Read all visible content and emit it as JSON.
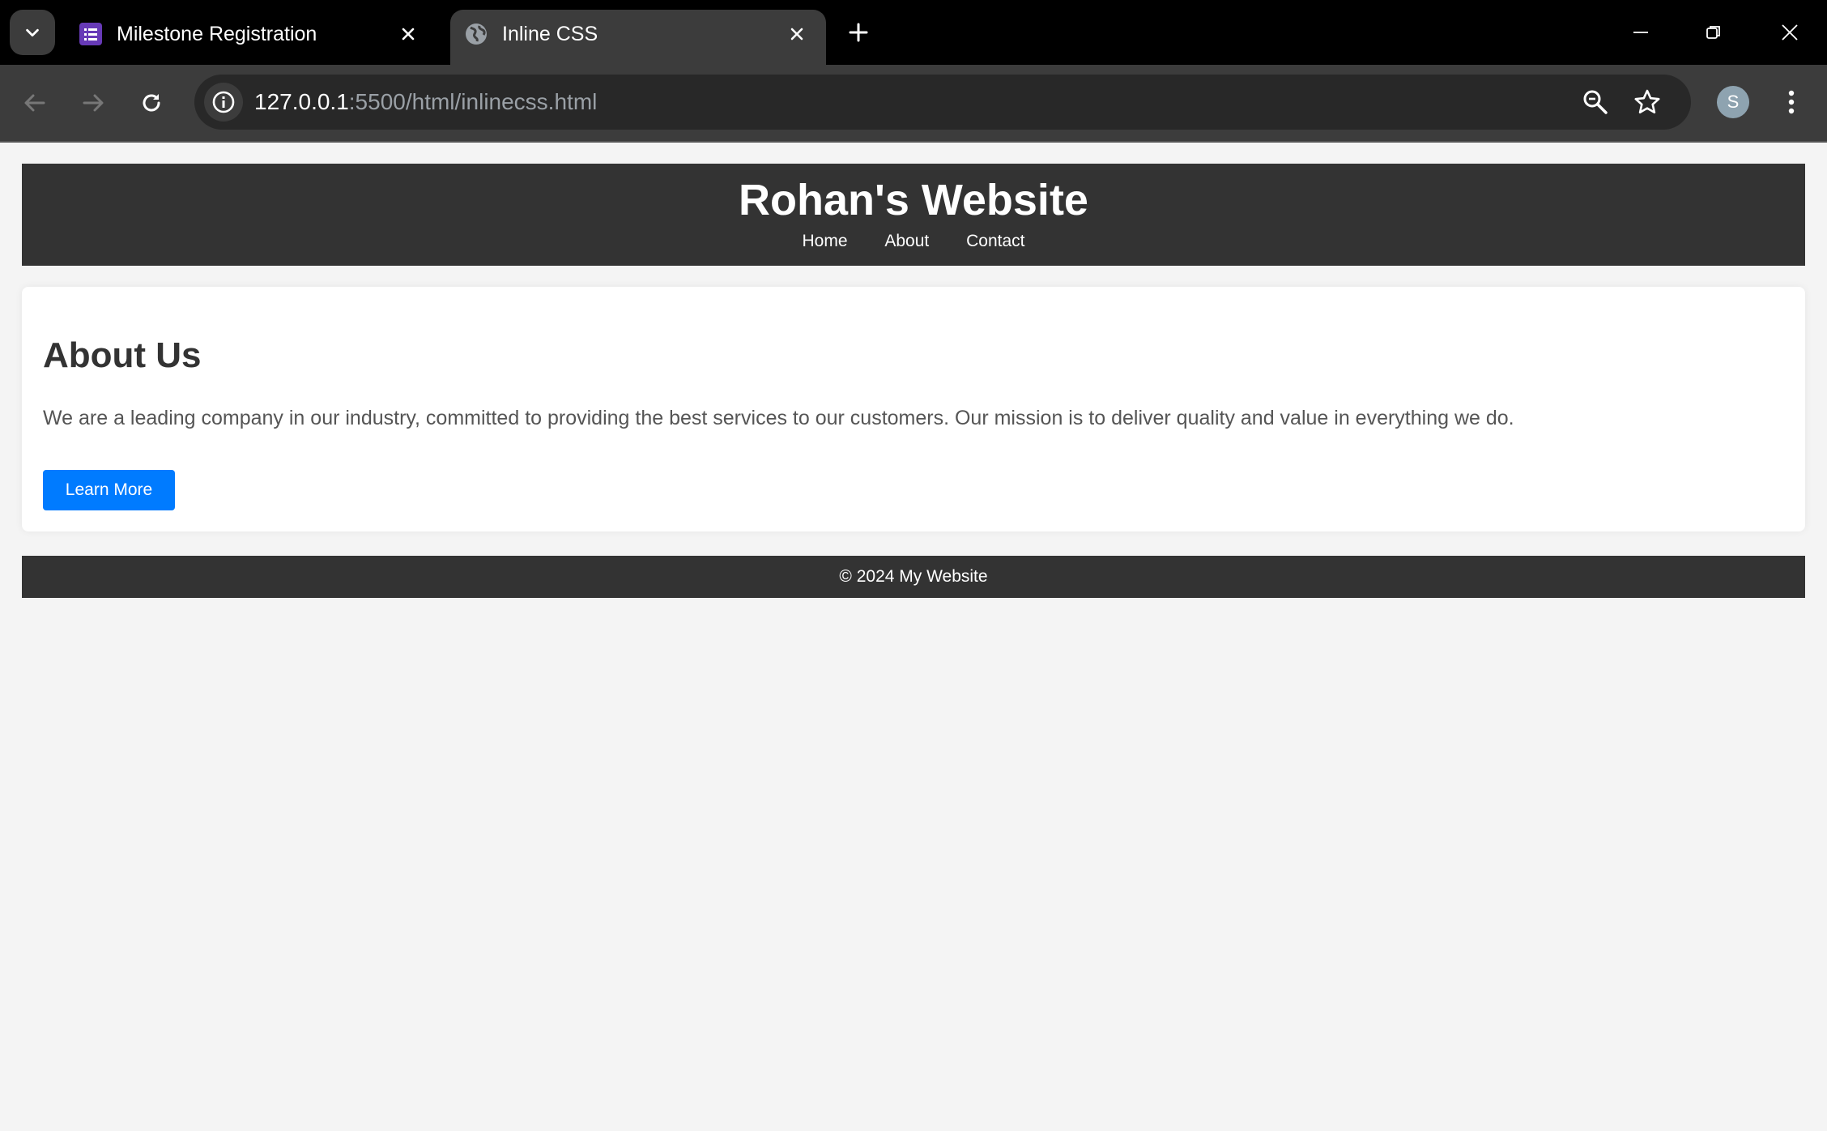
{
  "browser": {
    "tabs": [
      {
        "title": "Milestone Registration",
        "active": false,
        "favicon": "forms-icon"
      },
      {
        "title": "Inline CSS",
        "active": true,
        "favicon": "globe-icon"
      }
    ],
    "url_host": "127.0.0.1",
    "url_rest": ":5500/html/inlinecss.html",
    "profile_initial": "S"
  },
  "site": {
    "title": "Rohan's Website",
    "nav": [
      "Home",
      "About",
      "Contact"
    ],
    "heading": "About Us",
    "paragraph": "We are a leading company in our industry, committed to providing the best services to our customers. Our mission is to deliver quality and value in everything we do.",
    "button_label": "Learn More",
    "footer": "© 2024 My Website"
  },
  "colors": {
    "header_bg": "#333333",
    "button_bg": "#007bff",
    "page_bg": "#f4f4f4"
  }
}
